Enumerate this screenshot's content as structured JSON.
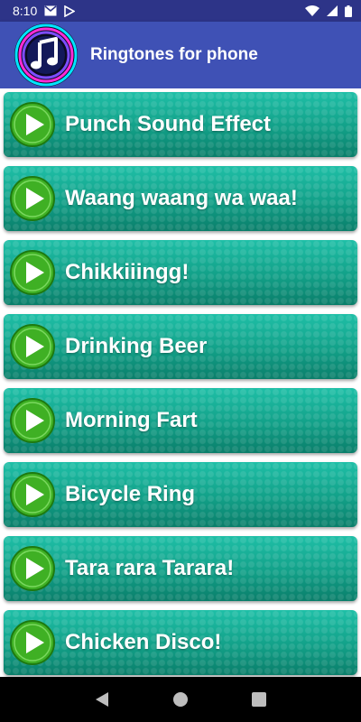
{
  "status_bar": {
    "time": "8:10",
    "icons": [
      "gmail-icon",
      "play-store-icon",
      "wifi-icon",
      "signal-icon",
      "battery-icon"
    ]
  },
  "app_bar": {
    "title": "Ringtones for phone",
    "logo_icon": "music-note-icon"
  },
  "ringtones": [
    {
      "name": "Punch Sound Effect"
    },
    {
      "name": "Waang waang wa waa!"
    },
    {
      "name": "Chikkiiingg!"
    },
    {
      "name": "Drinking Beer"
    },
    {
      "name": "Morning Fart"
    },
    {
      "name": "Bicycle Ring"
    },
    {
      "name": "Tara rara Tarara!"
    },
    {
      "name": "Chicken Disco!"
    }
  ],
  "nav_bar": {
    "buttons": [
      "back-icon",
      "home-icon",
      "recents-icon"
    ]
  },
  "colors": {
    "status_bar": "#2d3488",
    "app_bar": "#3f51b5",
    "item_teal": "#18a48f",
    "play_green": "#3fb024"
  }
}
